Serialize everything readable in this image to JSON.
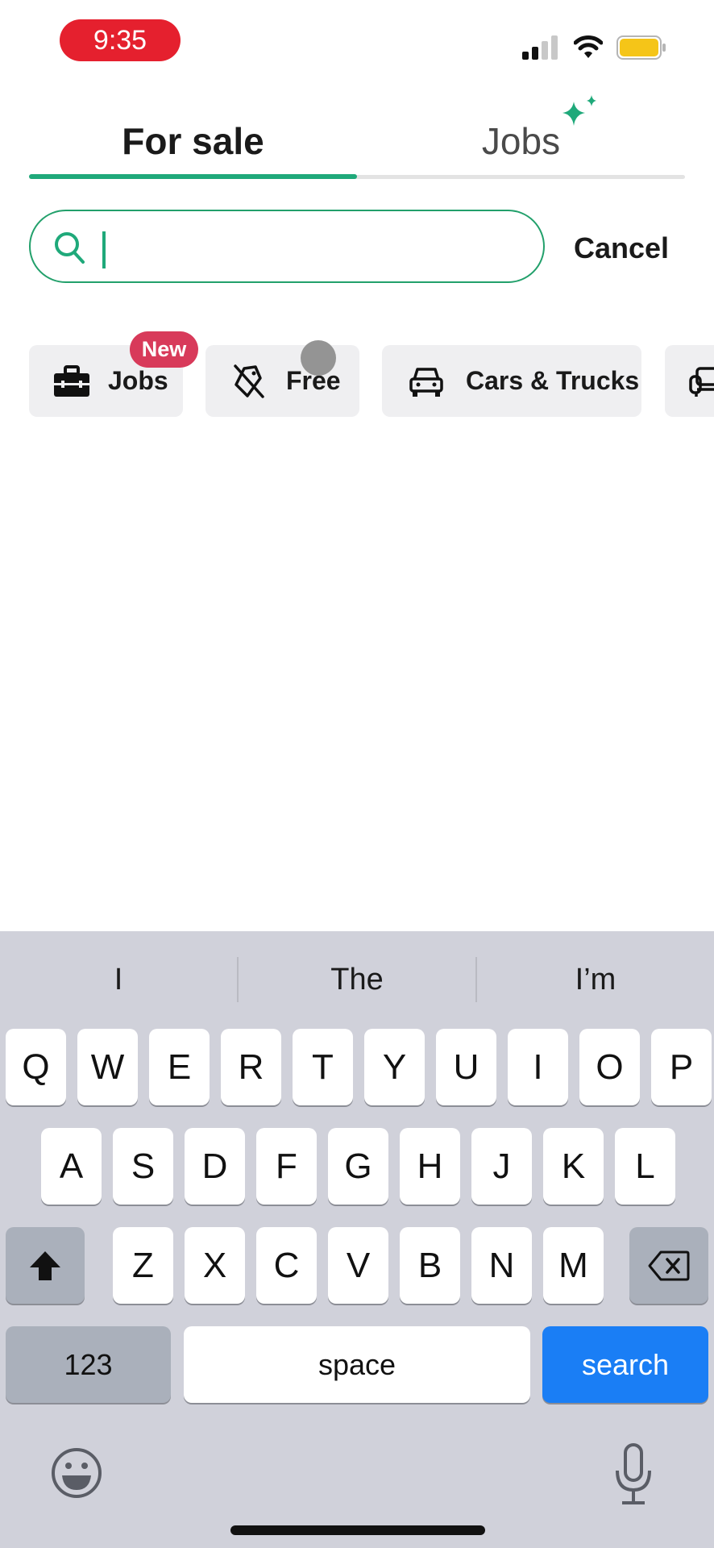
{
  "status_bar": {
    "time": "9:35",
    "icons": [
      "cellular-signal-icon",
      "wifi-icon",
      "battery-icon"
    ]
  },
  "tabs": [
    {
      "label": "For sale",
      "active": true
    },
    {
      "label": "Jobs",
      "active": false,
      "decoration": "sparkle-icon"
    }
  ],
  "colors": {
    "accent": "#1fa97a",
    "badge": "#d83a5a",
    "time_pill": "#e5202e",
    "keyboard_search": "#1a7ef5",
    "battery": "#f5c518"
  },
  "search": {
    "value": "",
    "placeholder": "",
    "cancel_label": "Cancel"
  },
  "categories": [
    {
      "label": "Jobs",
      "icon": "briefcase-icon",
      "badge": "New"
    },
    {
      "label": "Free",
      "icon": "free-tag-icon"
    },
    {
      "label": "Cars & Trucks",
      "icon": "car-icon"
    },
    {
      "label": "",
      "icon": "sofa-icon"
    }
  ],
  "keyboard": {
    "suggestions": [
      "I",
      "The",
      "I’m"
    ],
    "row1": [
      "Q",
      "W",
      "E",
      "R",
      "T",
      "Y",
      "U",
      "I",
      "O",
      "P"
    ],
    "row2": [
      "A",
      "S",
      "D",
      "F",
      "G",
      "H",
      "J",
      "K",
      "L"
    ],
    "row3": [
      "Z",
      "X",
      "C",
      "V",
      "B",
      "N",
      "M"
    ],
    "numbers_label": "123",
    "space_label": "space",
    "return_label": "search",
    "icons": [
      "shift-icon",
      "backspace-icon",
      "emoji-icon",
      "microphone-icon"
    ]
  }
}
